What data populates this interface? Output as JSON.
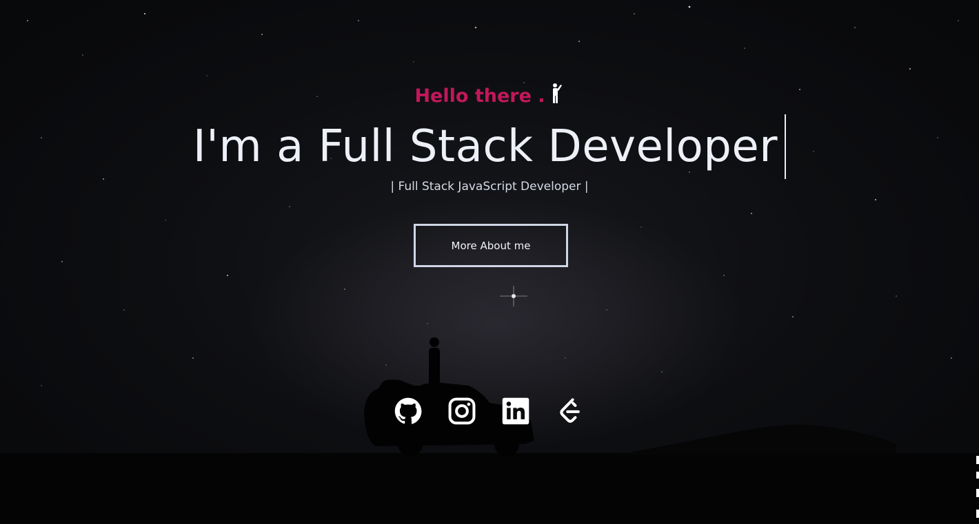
{
  "hero": {
    "greeting": "Hello there .",
    "headline": "I'm a Full Stack Developer",
    "subtitle": "| Full Stack JavaScript Developer |",
    "cta_label": "More About me"
  },
  "socials": [
    {
      "icon": "github-icon"
    },
    {
      "icon": "instagram-icon"
    },
    {
      "icon": "linkedin-icon"
    },
    {
      "icon": "leetcode-icon"
    }
  ],
  "colors": {
    "accent": "#c2185b",
    "text": "#eef0f8",
    "background": "#0d0e11",
    "button_border": "#cfd6e6"
  }
}
